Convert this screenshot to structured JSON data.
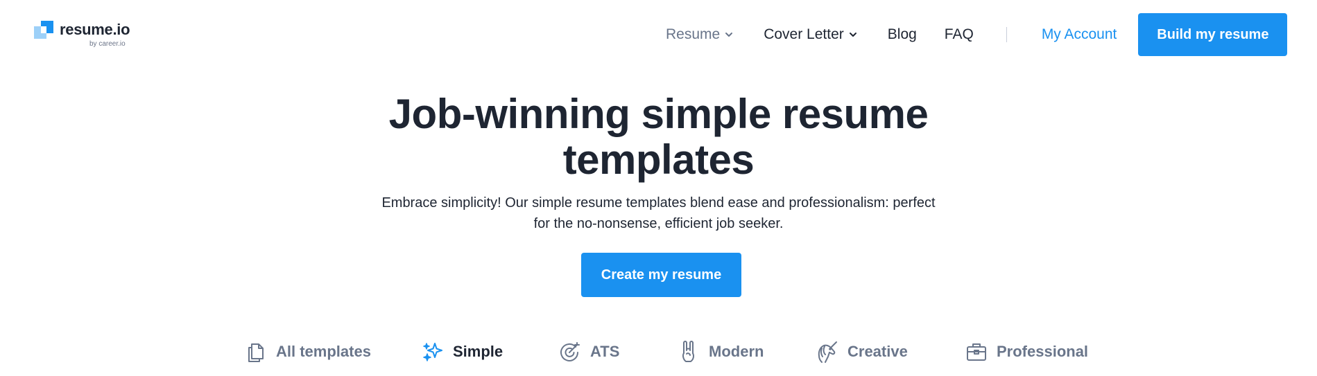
{
  "brand": {
    "name": "resume.io",
    "byline": "by career.io",
    "accent_color": "#1a91f0",
    "light_accent_color": "#9dd0f8"
  },
  "nav": {
    "items": [
      {
        "label": "Resume",
        "has_dropdown": true,
        "icon": "chevron-down-icon"
      },
      {
        "label": "Cover Letter",
        "has_dropdown": true,
        "icon": "chevron-down-icon"
      },
      {
        "label": "Blog",
        "has_dropdown": false
      },
      {
        "label": "FAQ",
        "has_dropdown": false
      }
    ],
    "account_label": "My Account",
    "cta_label": "Build my resume"
  },
  "hero": {
    "title_line1": "Job-winning simple resume",
    "title_line2": "templates",
    "desc_line1": "Embrace simplicity! Our simple resume templates blend ease and professionalism: perfect",
    "desc_line2": "for the no-nonsense, efficient job seeker.",
    "cta_label": "Create my resume"
  },
  "tabs": {
    "active": "Simple",
    "items": [
      {
        "label": "All templates",
        "icon": "copy-documents-icon"
      },
      {
        "label": "Simple",
        "icon": "sparkles-icon"
      },
      {
        "label": "ATS",
        "icon": "target-icon"
      },
      {
        "label": "Modern",
        "icon": "rock-hand-icon"
      },
      {
        "label": "Creative",
        "icon": "unicorn-icon"
      },
      {
        "label": "Professional",
        "icon": "briefcase-icon"
      }
    ]
  }
}
